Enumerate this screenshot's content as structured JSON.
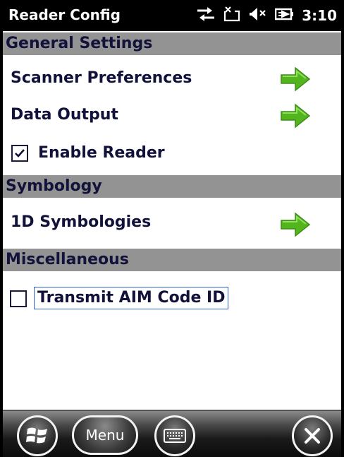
{
  "statusbar": {
    "title": "Reader Config",
    "time": "3:10",
    "icons": [
      "connectivity-icon",
      "message-icon",
      "volume-muted-icon",
      "battery-charging-icon"
    ]
  },
  "sections": {
    "general": {
      "header": "General Settings",
      "scanner_preferences": "Scanner Preferences",
      "data_output": "Data Output",
      "enable_reader": "Enable Reader",
      "enable_reader_checked": true
    },
    "symbology": {
      "header": "Symbology",
      "one_d": "1D Symbologies"
    },
    "misc": {
      "header": "Miscellaneous",
      "transmit_aim": "Transmit AIM Code ID",
      "transmit_aim_checked": false
    }
  },
  "bottombar": {
    "menu_label": "Menu"
  },
  "colors": {
    "section_bg": "#939393",
    "text": "#11113a",
    "arrow_green": "#52b51e",
    "focus": "#2d5fd8"
  }
}
